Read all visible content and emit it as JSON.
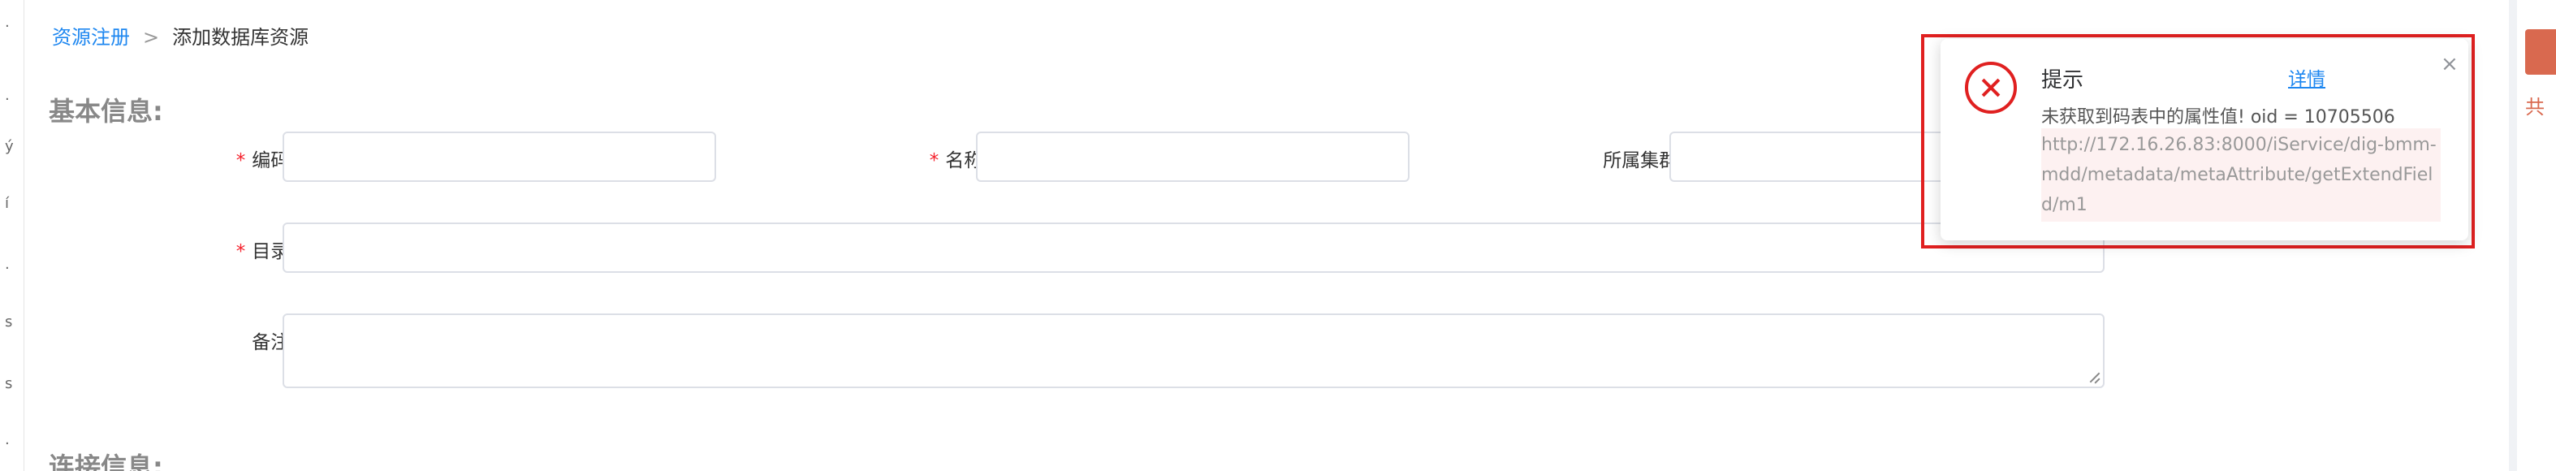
{
  "left_strip": {
    "glyphs": [
      "·",
      "·",
      "ý",
      "í",
      "·",
      "s",
      "s",
      "·"
    ]
  },
  "breadcrumb": {
    "root": "资源注册",
    "separator": ">",
    "current": "添加数据库资源"
  },
  "sections": {
    "basic_info": "基本信息:",
    "connection_info": "连接信息:"
  },
  "form": {
    "code_required": "*",
    "code_label": "编码:",
    "code_value": "",
    "name_required": "*",
    "name_label": "名称:",
    "name_value": "",
    "cluster_label": "所属集群:",
    "cluster_value": "",
    "catalog_required": "*",
    "catalog_label": "目录:",
    "catalog_value": "",
    "remark_label": "备注:",
    "remark_value": ""
  },
  "notification": {
    "title": "提示",
    "detail_link": "详情",
    "close_glyph": "×",
    "message": "未获取到码表中的属性值! oid = 10705506",
    "url": "http://172.16.26.83:8000/iService/dig-bmm-mdd/metadata/metaAttribute/getExtendField/m1",
    "icon": "error-circle-icon",
    "frame_color": "#e02020"
  },
  "right_strip": {
    "text": "共"
  },
  "colors": {
    "link": "#1e87f0",
    "required": "#f5222d",
    "accent": "#d9694f"
  }
}
